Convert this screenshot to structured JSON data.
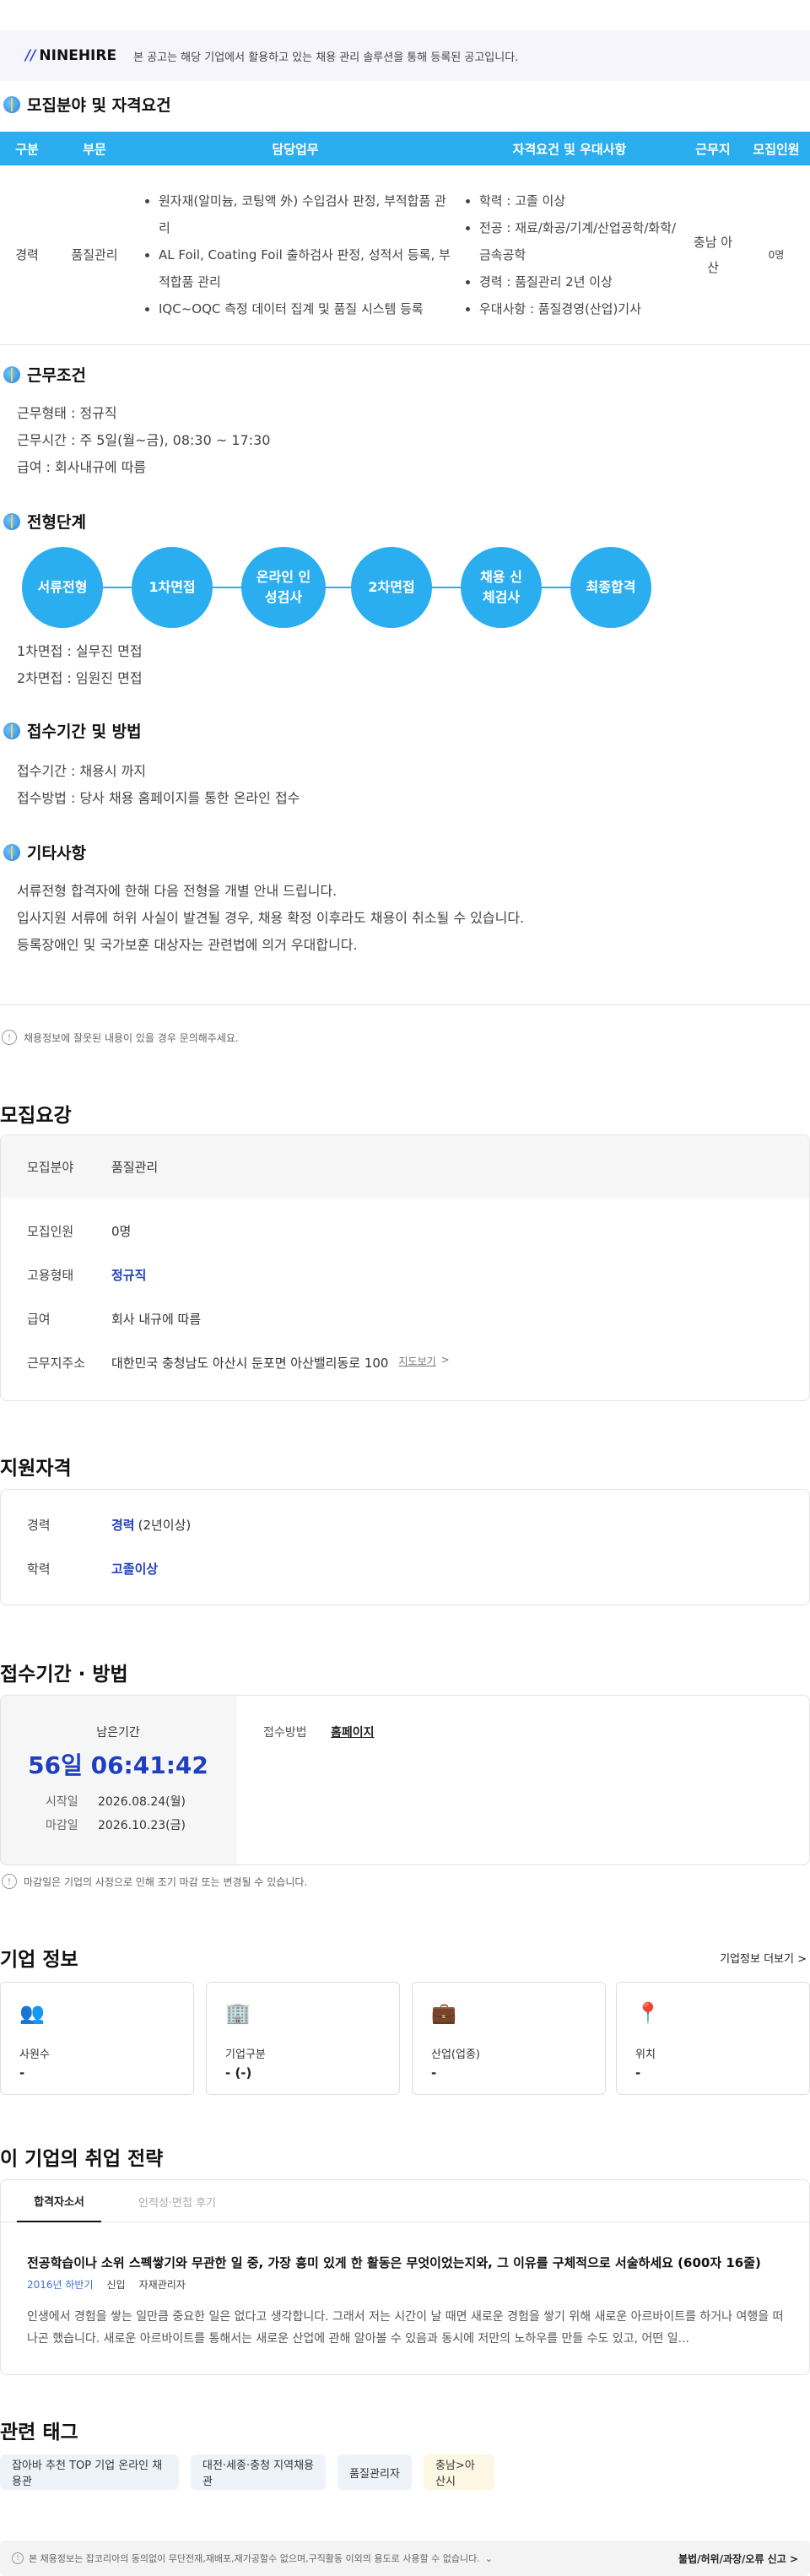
{
  "notice": {
    "brand": "NINEHIRE",
    "text": "본 공고는 해당 기업에서 활용하고 있는 채용 관리 솔루션을 통해 등록된 공고입니다."
  },
  "section1": {
    "title": "모집분야 및 자격요건",
    "headers": [
      "구분",
      "부문",
      "담당업무",
      "자격요건 및 우대사항",
      "근무지",
      "모집인원"
    ],
    "row": {
      "type": "경력",
      "dept": "품질관리",
      "duties": [
        "원자재(알미늄, 코팅액 外) 수입검사 판정, 부적합품 관리",
        "AL Foil, Coating Foil 출하검사 판정, 성적서 등록, 부적합품 관리",
        "IQC~OQC 측정 데이터 집계 및 품질 시스템 등록"
      ],
      "quals": [
        "학력 : 고졸 이상",
        "전공 : 재료/화공/기계/산업공학/화학/금속공학",
        "경력 : 품질관리 2년 이상",
        "우대사항 : 품질경영(산업)기사"
      ],
      "location": "충남 아산",
      "headcount": "0명"
    }
  },
  "section2": {
    "title": "근무조건",
    "lines": [
      "근무형태 : 정규직",
      "근무시간 : 주 5일(월~금), 08:30 ~ 17:30",
      "급여 : 회사내규에 따름"
    ]
  },
  "section3": {
    "title": "전형단계",
    "steps": [
      "서류전형",
      "1차면접",
      "온라인 인성검사",
      "2차면접",
      "채용 신체검사",
      "최종합격"
    ],
    "lines": [
      "1차면접 : 실무진 면접",
      "2차면접 : 임원진 면접"
    ]
  },
  "section4": {
    "title": "접수기간 및 방법",
    "lines": [
      "접수기간 : 채용시 까지",
      "접수방법 : 당사 채용 홈페이지를 통한 온라인 접수"
    ]
  },
  "section5": {
    "title": "기타사항",
    "lines": [
      "서류전형 합격자에 한해 다음 전형을 개별 안내 드립니다.",
      "입사지원 서류에 허위 사실이 발견될 경우, 채용 확정 이후라도 채용이 취소될 수 있습니다.",
      "등록장애인 및 국가보훈 대상자는 관련법에 의거 우대합니다."
    ]
  },
  "report_note": "채용정보에 잘못된 내용이 있을 경우 문의해주세요.",
  "summary": {
    "title": "모집요강",
    "field_label": "모집분야",
    "field_value": "품질관리",
    "count_label": "모집인원",
    "count_value": "0명",
    "emp_label": "고용형태",
    "emp_value": "정규직",
    "pay_label": "급여",
    "pay_value": "회사 내규에 따름",
    "addr_label": "근무지주소",
    "addr_value": "대한민국 충청남도 아산시 둔포면 아산밸리동로 100",
    "map_link": "지도보기"
  },
  "qual": {
    "title": "지원자격",
    "career_label": "경력",
    "career_value": "경력",
    "career_extra": "(2년이상)",
    "edu_label": "학력",
    "edu_value": "고졸이상"
  },
  "period": {
    "title": "접수기간 · 방법",
    "remain_label": "남은기간",
    "remain_value": "56일 06:41:42",
    "start_label": "시작일",
    "start_value": "2026.08.24(월)",
    "end_label": "마감일",
    "end_value": "2026.10.23(금)",
    "method_label": "접수방법",
    "method_value": "홈페이지",
    "note": "마감일은 기업의 사정으로 인해 조기 마감 또는 변경될 수 있습니다."
  },
  "company": {
    "title": "기업 정보",
    "more": "기업정보 더보기",
    "cards": [
      {
        "label": "사원수",
        "value": "-"
      },
      {
        "label": "기업구분",
        "value": "- (-)"
      },
      {
        "label": "산업(업종)",
        "value": "-"
      },
      {
        "label": "위치",
        "value": "-"
      }
    ]
  },
  "strategy": {
    "title": "이 기업의 취업 전략",
    "tabs": [
      "합격자소서",
      "인적성·면접 후기"
    ],
    "question": "전공학습이나 소위 스펙쌓기와 무관한 일 중, 가장 흥미 있게 한 활동은 무엇이었는지와, 그 이유를 구체적으로 서술하세요 (600자 16줄)",
    "meta": [
      "2016년 하반기",
      "신입",
      "자재관리자"
    ],
    "answer": "인생에서 경험을 쌓는 일만큼 중요한 일은 없다고 생각합니다. 그래서 저는 시간이 날 때면 새로운 경험을 쌓기 위해 새로운 아르바이트를 하거나 여행을 떠나곤 했습니다. 새로운 아르바이트를 통해서는 새로운 산업에 관해 알아볼 수 있음과 동시에 저만의 노하우를 만들 수도 있고, 어떤 일..."
  },
  "tags": {
    "title": "관련 태그",
    "items": [
      "잡아바 추천 TOP 기업 온라인 채용관",
      "대전·세종·충청 지역채용관",
      "품질관리자",
      "충남>아산시"
    ]
  },
  "footer": {
    "text": "본 채용정보는 잡코리아의 동의없이 무단전재,재배포,재가공할수 없으며,구직활동 이외의 용도로 사용할 수 없습니다.",
    "report": "불법/허위/과장/오류 신고"
  }
}
